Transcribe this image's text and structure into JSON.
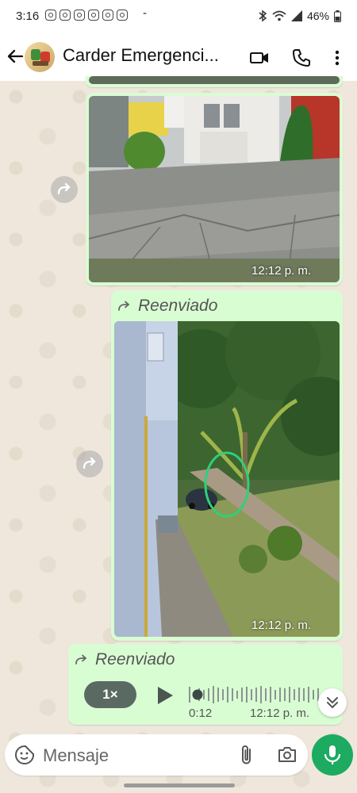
{
  "status_bar": {
    "time": "3:16",
    "notif_dash": "-",
    "battery": "46%"
  },
  "header": {
    "title": "Carder Emergenci...",
    "icons": [
      "back-arrow-icon",
      "video-call-icon",
      "phone-icon",
      "more-vert-icon"
    ]
  },
  "messages": [
    {
      "type": "image",
      "time": "12:12 p. m.",
      "forwarded": false
    },
    {
      "type": "image",
      "time": "12:12 p. m.",
      "forwarded": true,
      "forwarded_label": "Reenviado"
    },
    {
      "type": "voice",
      "time": "12:12 p. m.",
      "forwarded": true,
      "forwarded_label": "Reenviado",
      "speed": "1×",
      "duration": "0:12"
    }
  ],
  "composer": {
    "placeholder": "Mensaje",
    "icons": [
      "sticker-icon",
      "attach-icon",
      "camera-icon",
      "mic-icon"
    ]
  },
  "colors": {
    "bubble_outgoing": "#d9fdd3",
    "accent_green": "#1daa61",
    "wallpaper": "#efe7dc"
  }
}
